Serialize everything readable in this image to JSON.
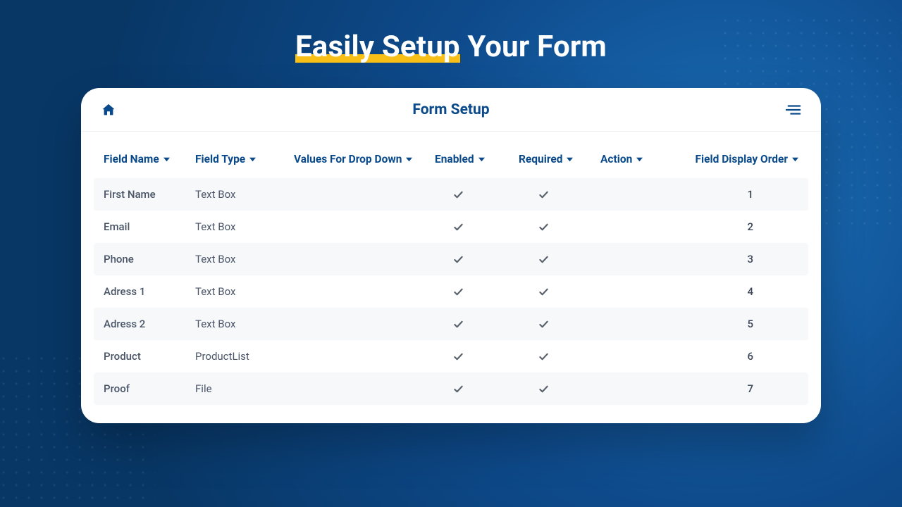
{
  "hero": {
    "highlight": "Easily Setup",
    "rest": " Your Form"
  },
  "panel": {
    "title": "Form Setup"
  },
  "columns": {
    "name": "Field Name",
    "type": "Field Type",
    "values": "Values For Drop Down",
    "enabled": "Enabled",
    "required": "Required",
    "action": "Action",
    "order": "Field Display Order"
  },
  "rows": [
    {
      "name": "First Name",
      "type": "Text Box",
      "enabled": true,
      "required": true,
      "order": "1"
    },
    {
      "name": "Email",
      "type": "Text Box",
      "enabled": true,
      "required": true,
      "order": "2"
    },
    {
      "name": "Phone",
      "type": "Text Box",
      "enabled": true,
      "required": true,
      "order": "3"
    },
    {
      "name": "Adress 1",
      "type": "Text Box",
      "enabled": true,
      "required": true,
      "order": "4"
    },
    {
      "name": "Adress 2",
      "type": "Text Box",
      "enabled": true,
      "required": true,
      "order": "5"
    },
    {
      "name": "Product",
      "type": "ProductList",
      "enabled": true,
      "required": true,
      "order": "6"
    },
    {
      "name": "Proof",
      "type": "File",
      "enabled": true,
      "required": true,
      "order": "7"
    }
  ]
}
